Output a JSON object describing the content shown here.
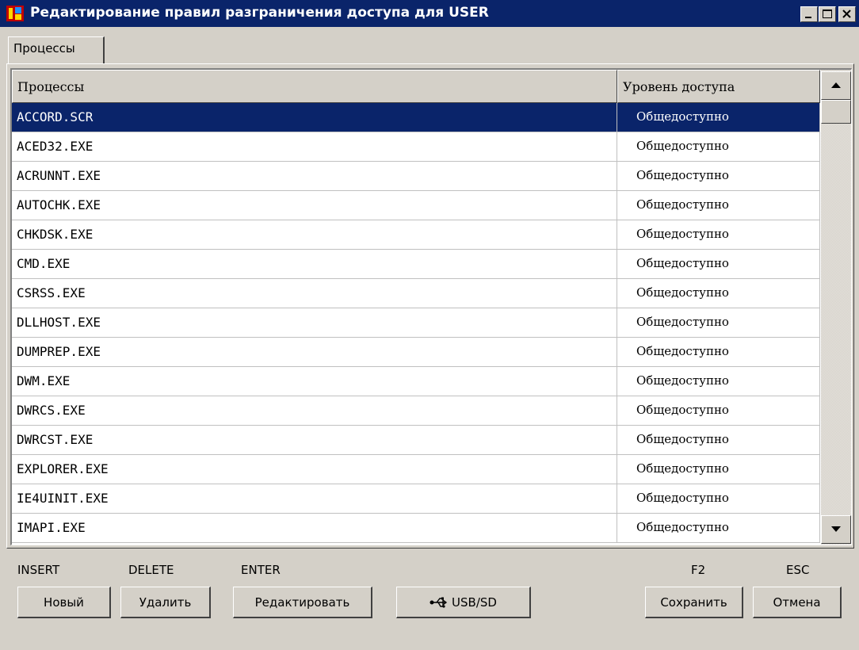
{
  "window": {
    "title": "Редактирование правил разграничения доступа для USER",
    "title_bar_color": "#0a246a"
  },
  "tabs": [
    {
      "label": "Процессы"
    }
  ],
  "table": {
    "columns": [
      "Процессы",
      "Уровень доступа"
    ],
    "selected_row": 0,
    "selection_color": "#0a246a",
    "rows": [
      {
        "process": "ACCORD.SCR",
        "level": "Общедоступно"
      },
      {
        "process": "ACED32.EXE",
        "level": "Общедоступно"
      },
      {
        "process": "ACRUNNT.EXE",
        "level": "Общедоступно"
      },
      {
        "process": "AUTOCHK.EXE",
        "level": "Общедоступно"
      },
      {
        "process": "CHKDSK.EXE",
        "level": "Общедоступно"
      },
      {
        "process": "CMD.EXE",
        "level": "Общедоступно"
      },
      {
        "process": "CSRSS.EXE",
        "level": "Общедоступно"
      },
      {
        "process": "DLLHOST.EXE",
        "level": "Общедоступно"
      },
      {
        "process": "DUMPREP.EXE",
        "level": "Общедоступно"
      },
      {
        "process": "DWM.EXE",
        "level": "Общедоступно"
      },
      {
        "process": "DWRCS.EXE",
        "level": "Общедоступно"
      },
      {
        "process": "DWRCST.EXE",
        "level": "Общедоступно"
      },
      {
        "process": "EXPLORER.EXE",
        "level": "Общедоступно"
      },
      {
        "process": "IE4UINIT.EXE",
        "level": "Общедоступно"
      },
      {
        "process": "IMAPI.EXE",
        "level": "Общедоступно"
      }
    ]
  },
  "shortcuts": {
    "insert": "INSERT",
    "delete": "DELETE",
    "enter": "ENTER",
    "f2": "F2",
    "esc": "ESC"
  },
  "buttons": {
    "new": "Новый",
    "delete": "Удалить",
    "edit": "Редактировать",
    "usb": "USB/SD",
    "save": "Сохранить",
    "cancel": "Отмена"
  },
  "icons": {
    "app": "app-icon",
    "minimize": "minimize-icon",
    "maximize": "maximize-icon",
    "close": "close-icon",
    "usb": "usb-icon",
    "scroll_up": "arrow-up-icon",
    "scroll_down": "arrow-down-icon"
  }
}
